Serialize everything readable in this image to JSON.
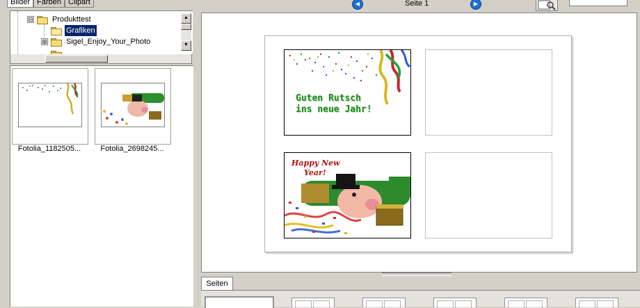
{
  "library_tabs": [
    "Bilder",
    "Farben",
    "Clipart"
  ],
  "tree": {
    "items": [
      {
        "label": "Produkttest",
        "expander": "⊟"
      },
      {
        "label": "Grafiken",
        "selected": true
      },
      {
        "label": "Sigel_Enjoy_Your_Photo",
        "expander": "⊞"
      }
    ]
  },
  "thumbnails": [
    {
      "caption": "Fotolia_1182505..."
    },
    {
      "caption": "Fotolia_2698245..."
    }
  ],
  "toolbar": {
    "page_label": "Seite 1",
    "prev_icon": "◀",
    "next_icon": "▶"
  },
  "cards": {
    "card1_text": [
      "Guten Rutsch",
      "ins neue Jahr!"
    ],
    "card3_text": [
      "Happy New",
      "Year!"
    ]
  },
  "pages_panel": {
    "tab_label": "Seiten"
  },
  "colors": {
    "selection": "#0a246a",
    "greeting_green": "#1e8a1e",
    "greeting_red": "#b01010"
  }
}
